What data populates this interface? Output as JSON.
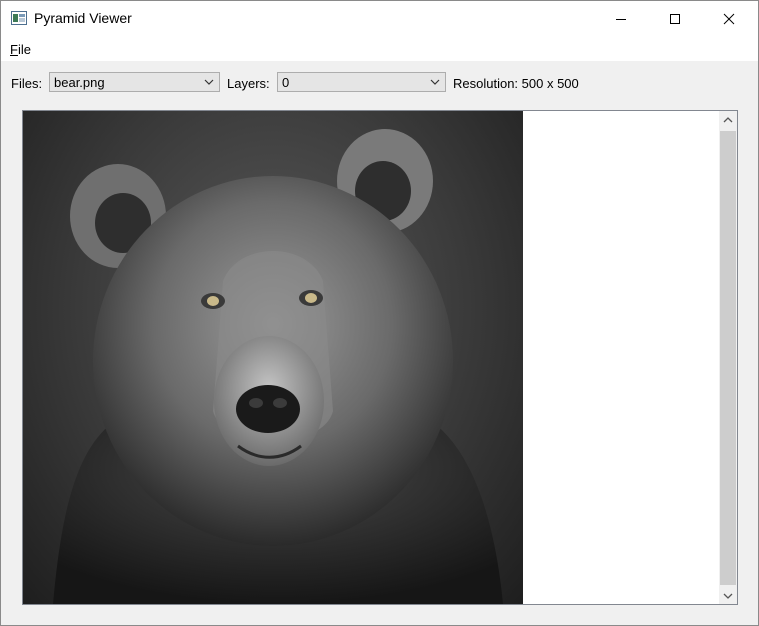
{
  "window": {
    "title": "Pyramid Viewer"
  },
  "menu": {
    "file_accel": "F",
    "file_rest": "ile"
  },
  "toolbar": {
    "files_label": "Files:",
    "files_value": "bear.png",
    "layers_label": "Layers:",
    "layers_value": "0",
    "resolution_text": "Resolution: 500 x 500"
  },
  "viewer": {
    "scrollbar": "vertical"
  },
  "colors": {
    "titlebar_bg": "#ffffff",
    "window_bg": "#f0f0f0",
    "combo_bg": "#e5e5e5",
    "scroll_thumb": "#cdcdcd"
  }
}
